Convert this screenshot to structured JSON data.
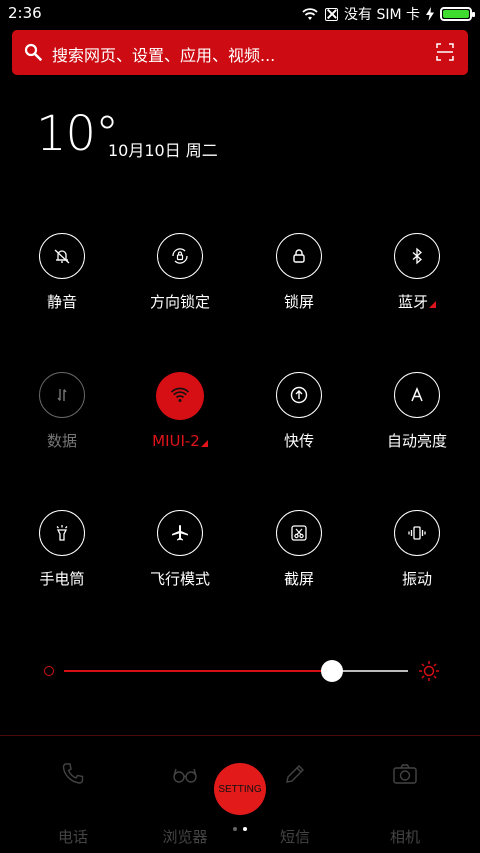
{
  "status_bar": {
    "time": "2:36",
    "carrier": "没有 SIM 卡",
    "battery_level": 1.0
  },
  "search": {
    "placeholder": "搜索网页、设置、应用、视频..."
  },
  "weather": {
    "temperature": "10°",
    "date": "10月10日 周二"
  },
  "toggles": [
    {
      "label": "静音",
      "icon": "bell-off-icon",
      "state": "off"
    },
    {
      "label": "方向锁定",
      "icon": "rotation-lock-icon",
      "state": "off"
    },
    {
      "label": "锁屏",
      "icon": "lock-icon",
      "state": "off"
    },
    {
      "label": "蓝牙",
      "icon": "bluetooth-icon",
      "state": "off",
      "has_more": true
    },
    {
      "label": "数据",
      "icon": "data-arrows-icon",
      "state": "disabled"
    },
    {
      "label": "MIUI-2",
      "icon": "wifi-icon",
      "state": "on",
      "has_more": true
    },
    {
      "label": "快传",
      "icon": "upload-arrow-icon",
      "state": "off"
    },
    {
      "label": "自动亮度",
      "icon": "auto-brightness-icon",
      "state": "off"
    },
    {
      "label": "手电筒",
      "icon": "flashlight-icon",
      "state": "off"
    },
    {
      "label": "飞行模式",
      "icon": "airplane-icon",
      "state": "off"
    },
    {
      "label": "截屏",
      "icon": "screenshot-icon",
      "state": "off"
    },
    {
      "label": "振动",
      "icon": "vibrate-icon",
      "state": "off"
    }
  ],
  "brightness": {
    "value": 0.78
  },
  "dock": [
    {
      "label": "电话",
      "icon": "phone-icon"
    },
    {
      "label": "浏览器",
      "icon": "glasses-icon"
    },
    {
      "label": "短信",
      "icon": "pencil-icon"
    },
    {
      "label": "相机",
      "icon": "camera-icon"
    }
  ],
  "floating_button": {
    "label": "SETTING"
  },
  "page_indicator": {
    "count": 2,
    "current": 2
  },
  "colors": {
    "accent": "#d50f14",
    "background": "#000000",
    "battery": "#3ddc2f"
  }
}
